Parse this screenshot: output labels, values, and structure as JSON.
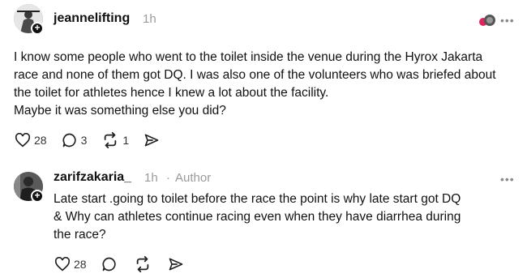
{
  "post": {
    "username": "jeannelifting",
    "time": "1h",
    "more_label": "•••",
    "text_lines": [
      "I know some people who went to the toilet inside the venue during the Hyrox Jakarta",
      "race and none of them got DQ. I was also one of the volunteers who was briefed about",
      "the toilet for athletes hence I knew a lot about the facility.",
      "Maybe it was something else you did?"
    ],
    "likes": "28",
    "replies": "3",
    "reposts": "1",
    "icons": {
      "like": "heart-icon",
      "reply": "comment-icon",
      "repost": "repost-icon",
      "share": "share-icon"
    }
  },
  "reply": {
    "username": "zarifzakaria_",
    "time": "1h",
    "separator": "·",
    "author_label": "Author",
    "more_label": "•••",
    "text_lines": [
      "Late start .going to toilet before the race the point is why late start got DQ",
      "& Why can athletes continue racing even when they have diarrhea during",
      "the race?"
    ],
    "likes": "28"
  },
  "badge_plus": "+"
}
